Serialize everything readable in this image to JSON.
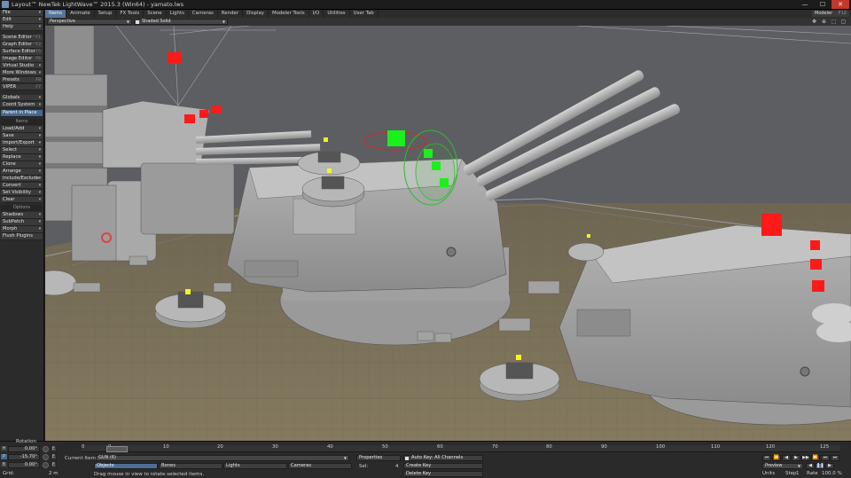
{
  "window": {
    "title": "Layout™ NewTek LightWave™ 2015.3 (Win64) - yamato.lws",
    "minimize": "—",
    "maximize": "☐",
    "close": "✕"
  },
  "left_panel": {
    "items_top": [
      {
        "label": "File",
        "arrow": "▾"
      },
      {
        "label": "Edit",
        "arrow": "▾"
      },
      {
        "label": "Help",
        "arrow": "▾"
      }
    ],
    "items_mid": [
      {
        "label": "Scene Editor",
        "shortcut": "^F1"
      },
      {
        "label": "Graph Editor",
        "shortcut": "^F2"
      },
      {
        "label": "Surface Editor",
        "shortcut": "F5"
      },
      {
        "label": "Image Editor",
        "shortcut": "F6"
      },
      {
        "label": "Virtual Studio",
        "arrow": "▾"
      },
      {
        "label": "More Windows",
        "arrow": "▾"
      },
      {
        "label": "Presets",
        "shortcut": "F8"
      },
      {
        "label": "VIPER",
        "shortcut": "F7"
      }
    ],
    "items_global": [
      {
        "label": "Globals",
        "arrow": "▾"
      },
      {
        "label": "Coord System",
        "arrow": "▾"
      }
    ],
    "parent_in_place": "Parent in Place",
    "items_header": "Items",
    "items_list": [
      {
        "label": "Load/Add",
        "arrow": "▾"
      },
      {
        "label": "Save",
        "arrow": "▾"
      },
      {
        "label": "Import/Export",
        "arrow": "▾"
      },
      {
        "label": "Select",
        "arrow": "▾"
      },
      {
        "label": "Replace",
        "arrow": "▾"
      },
      {
        "label": "Clone",
        "arrow": "▾"
      },
      {
        "label": "Arrange",
        "arrow": "▾"
      },
      {
        "label": "Include/Exclude",
        "arrow": "▾"
      },
      {
        "label": "Convert",
        "arrow": "▾"
      },
      {
        "label": "Set Visibility",
        "arrow": "▾"
      },
      {
        "label": "Clear",
        "arrow": "▾"
      }
    ],
    "options_header": "Options",
    "options_list": [
      {
        "label": "Shadows",
        "arrow": "▾"
      },
      {
        "label": "SubPatch",
        "arrow": "▾"
      },
      {
        "label": "Morph",
        "arrow": "▾"
      },
      {
        "label": "Flush Plugins",
        "arrow": ""
      }
    ]
  },
  "tabs": [
    "Items",
    "Animate",
    "Setup",
    "FX Tools",
    "Scene",
    "Lights",
    "Cameras",
    "Render",
    "Display",
    "Modeler Tools",
    "I/O",
    "Utilities",
    "User Tab"
  ],
  "active_tab": "Items",
  "modeler_button": {
    "label": "Modeler",
    "shortcut": "F12"
  },
  "viewport_header": {
    "view_mode": "Perspective",
    "shading_mode": "Shaded Solid",
    "icons": [
      "✥",
      "⊕",
      "⬚",
      "▢"
    ]
  },
  "bottom": {
    "rotation_label": "Rotation",
    "h": {
      "axis": "H",
      "value": "0.00°"
    },
    "p": {
      "axis": "P",
      "value": "-15.70°"
    },
    "b": {
      "axis": "B",
      "value": "0.00°"
    },
    "grid_label": "Grid:",
    "grid_value": "2 m",
    "current_item_label": "Current Item",
    "current_item_value": "GUN (6)",
    "item_type_buttons": [
      "Objects",
      "Bones",
      "Lights",
      "Cameras"
    ],
    "properties_label": "Properties",
    "sel_label": "Sel:",
    "sel_value": "4",
    "auto_key_label": "Auto Key: All Channels",
    "create_key": "Create Key",
    "delete_key": "Delete Key",
    "status_message": "Drag mouse in view to rotate selected items.",
    "timeline_ticks": [
      "0",
      "0",
      "10",
      "20",
      "30",
      "40",
      "50",
      "60",
      "70",
      "80",
      "90",
      "100",
      "110",
      "120",
      "125"
    ],
    "preview_label": "Preview",
    "units_label": "Units",
    "step_label": "Step",
    "step_value": "1",
    "rate_label": "Rate",
    "rate_value": "100.0 %"
  }
}
